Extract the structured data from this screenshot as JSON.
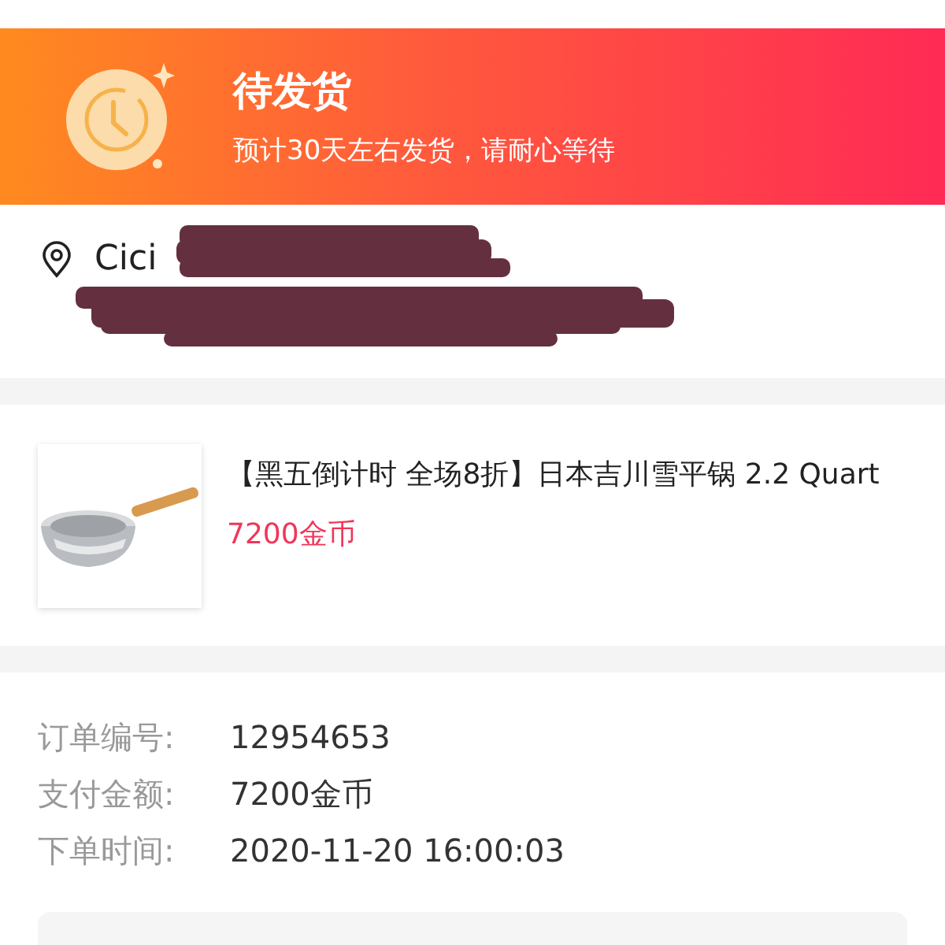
{
  "status": {
    "title": "待发货",
    "subtitle": "预计30天左右发货，请耐心等待"
  },
  "address": {
    "name": "Cici"
  },
  "product": {
    "title": "【黑五倒计时 全场8折】日本吉川雪平锅 2.2 Quart",
    "price": "7200金币"
  },
  "order_info": [
    {
      "label": "订单编号:",
      "value": "12954653"
    },
    {
      "label": "支付金额:",
      "value": "7200金币"
    },
    {
      "label": "下单时间:",
      "value": "2020-11-20 16:00:03"
    }
  ]
}
